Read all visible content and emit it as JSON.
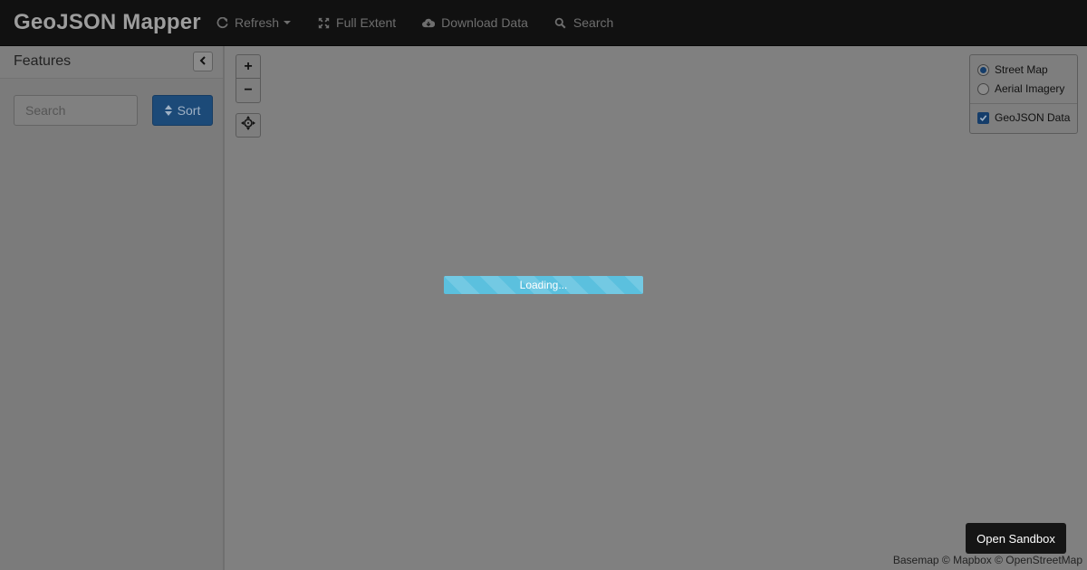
{
  "navbar": {
    "brand": "GeoJSON Mapper",
    "items": [
      {
        "label": "Refresh",
        "icon": "refresh-icon",
        "dropdown": true
      },
      {
        "label": "Full Extent",
        "icon": "expand-icon"
      },
      {
        "label": "Download Data",
        "icon": "cloud-download-icon"
      },
      {
        "label": "Search",
        "icon": "search-icon"
      }
    ]
  },
  "sidebar": {
    "title": "Features",
    "collapse_icon": "chevron-left-icon",
    "search": {
      "placeholder": "Search",
      "value": ""
    },
    "sort_label": "Sort",
    "sort_icon": "sort-icon"
  },
  "map": {
    "zoom_in": "+",
    "zoom_out": "−",
    "locate_icon": "crosshair-icon",
    "layers": {
      "basemaps": [
        {
          "label": "Street Map",
          "selected": true
        },
        {
          "label": "Aerial Imagery",
          "selected": false
        }
      ],
      "overlays": [
        {
          "label": "GeoJSON Data",
          "checked": true
        }
      ]
    },
    "loading_text": "Loading...",
    "attribution": "Basemap © Mapbox © OpenStreetMap",
    "sandbox_label": "Open Sandbox"
  },
  "colors": {
    "navbar_bg": "#111111",
    "primary": "#1c4a78",
    "progress": "#5bc0de"
  }
}
